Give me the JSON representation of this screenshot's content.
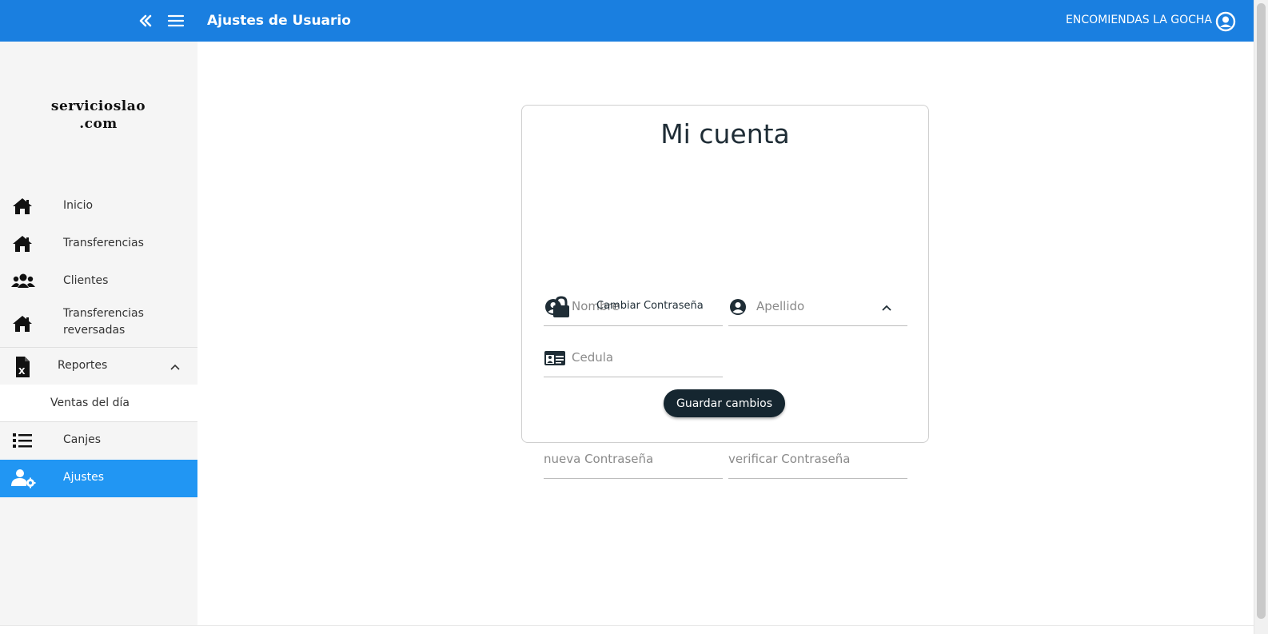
{
  "header": {
    "page_title": "Ajustes de Usuario",
    "company": "ENCOMIENDAS LA GOCHA",
    "collapse_icon": "double-chevron-left-icon",
    "menu_icon": "hamburger-menu-icon",
    "account_icon": "user-circle-icon"
  },
  "sidebar": {
    "logo_line1": "servicioslao",
    "logo_line2": ".com",
    "items": [
      {
        "label": "Inicio",
        "icon": "home-icon"
      },
      {
        "label": "Transferencias",
        "icon": "home-icon"
      },
      {
        "label": "Clientes",
        "icon": "users-icon"
      },
      {
        "label_line1": "Transferencias",
        "label_line2": "reversadas",
        "icon": "home-icon"
      },
      {
        "label": "Reportes",
        "icon": "excel-file-icon",
        "expanded": true,
        "children": [
          {
            "label": "Ventas del día"
          }
        ]
      },
      {
        "label": "Canjes",
        "icon": "list-icon"
      },
      {
        "label": "Ajustes",
        "icon": "user-gear-icon",
        "active": true
      }
    ]
  },
  "form": {
    "title": "Mi cuenta",
    "nombre_placeholder": "Nombre",
    "apellido_placeholder": "Apellido",
    "cedula_placeholder": "Cedula",
    "password_section_label": "Cambiar Contraseña",
    "nueva_placeholder": "nueva Contraseña",
    "verificar_placeholder": "verificar Contraseña",
    "save_label": "Guardar cambios"
  },
  "colors": {
    "header_bg": "#1a7fe0",
    "active_item_bg": "#2196f3",
    "button_bg": "#152630",
    "sidebar_bg": "#f5f5f5"
  }
}
